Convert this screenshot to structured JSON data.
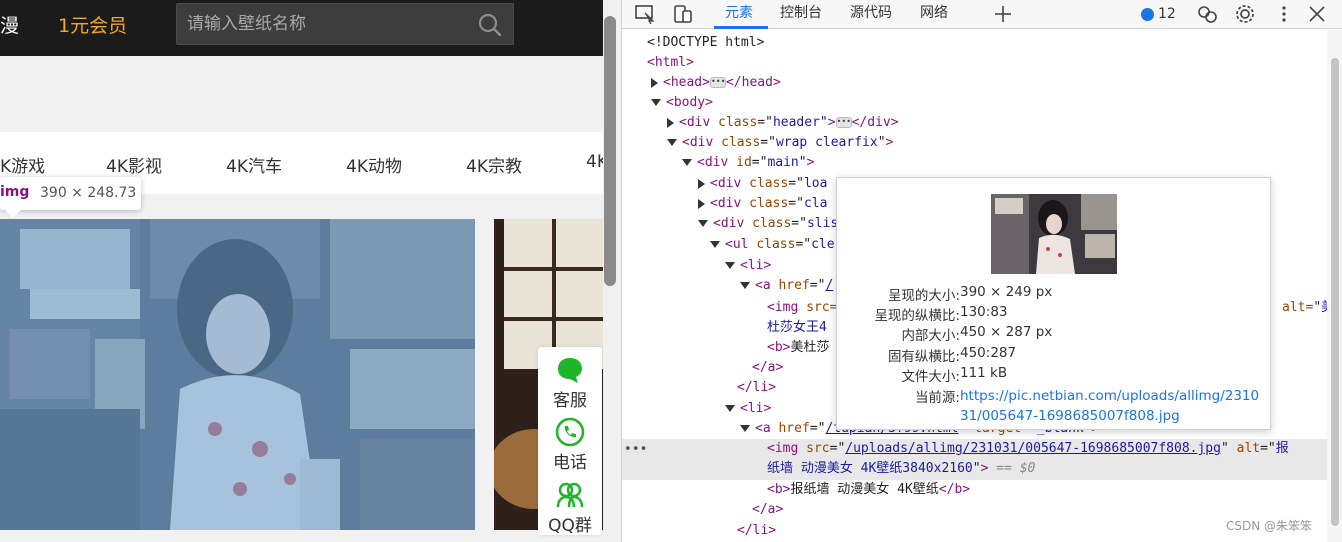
{
  "site": {
    "nav": {
      "anime": "漫",
      "vip": "1元会员"
    },
    "search": {
      "placeholder": "请输入壁纸名称"
    },
    "categories": [
      "K游戏",
      "4K影视",
      "4K汽车",
      "4K动物",
      "4K宗教",
      "4K"
    ],
    "tooltip": {
      "tag": "img",
      "size": "390 × 248.73"
    },
    "float_panel": {
      "service": "客服",
      "phone": "电话",
      "qq": "QQ群"
    }
  },
  "devtools": {
    "tabs": [
      "元素",
      "控制台",
      "源代码",
      "网络"
    ],
    "issues_count": "12",
    "lines": [
      {
        "indent": 0,
        "html": "<!DOCTYPE html>"
      },
      {
        "indent": 0,
        "tag": "html"
      },
      {
        "indent": 1,
        "collapsed": true,
        "tag": "head"
      },
      {
        "indent": 1,
        "tag": "body"
      },
      {
        "indent": 2,
        "collapsed": true,
        "tag": "div",
        "cls": "header"
      },
      {
        "indent": 2,
        "tag": "div",
        "cls": "wrap clearfix"
      },
      {
        "indent": 3,
        "tag": "div",
        "id": "main"
      },
      {
        "indent": 4,
        "collapsed": true,
        "tag": "div",
        "cls": "loa"
      },
      {
        "indent": 4,
        "collapsed": true,
        "tag": "div",
        "cls": "cla"
      },
      {
        "indent": 4,
        "tag": "div",
        "cls": "slis"
      },
      {
        "indent": 5,
        "tag": "ul",
        "cls": "cle"
      },
      {
        "indent": 6,
        "tag": "li"
      },
      {
        "indent": 7,
        "tag": "a",
        "href": "/"
      }
    ],
    "img1": {
      "src": "<img src=",
      "alt_attr": "alt=\"美",
      "alt_cont": "杜莎女王4",
      "b": "美杜莎"
    },
    "selected": {
      "href": "/tupian/3?99.html",
      "target": "_blank",
      "src": "/uploads/allimg/231031/005647-1698685007f808.jpg",
      "alt": "报纸墙 动漫美女 4K壁纸3840x2160",
      "b_text": "报纸墙 动漫美女 4K壁纸",
      "eq": "== $0"
    },
    "popover": {
      "rendered_size_label": "呈现的大小:",
      "rendered_size": "390 × 249 px",
      "rendered_ratio_label": "呈现的纵横比:",
      "rendered_ratio": "130:83",
      "intrinsic_size_label": "内部大小:",
      "intrinsic_size": "450 × 287 px",
      "intrinsic_ratio_label": "固有纵横比:",
      "intrinsic_ratio": "450:287",
      "file_size_label": "文件大小:",
      "file_size": "111 kB",
      "source_label": "当前源:",
      "source": "https://pic.netbian.com/uploads/allimg/231031/005647-1698685007f808.jpg"
    }
  },
  "watermark": "CSDN @朱笨笨"
}
